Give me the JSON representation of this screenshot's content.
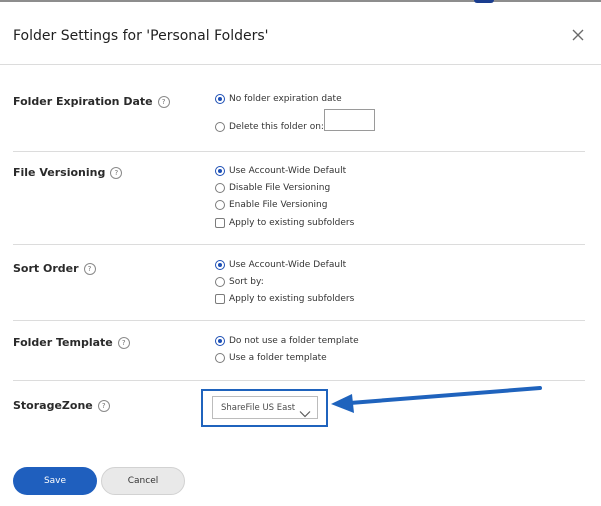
{
  "dialog": {
    "title": "Folder Settings for 'Personal Folders'",
    "close_icon": "close-icon"
  },
  "help_glyph": "?",
  "sections": {
    "expiration": {
      "label": "Folder Expiration Date",
      "options": [
        "No folder expiration date",
        "Delete this folder on:"
      ],
      "selected": "No folder expiration date",
      "date_value": ""
    },
    "versioning": {
      "label": "File Versioning",
      "options": [
        "Use Account-Wide Default",
        "Disable File Versioning",
        "Enable File Versioning"
      ],
      "selected": "Use Account-Wide Default",
      "apply_label": "Apply to existing subfolders",
      "apply_checked": false
    },
    "sort": {
      "label": "Sort Order",
      "options": [
        "Use Account-Wide Default",
        "Sort by:"
      ],
      "selected": "Use Account-Wide Default",
      "apply_label": "Apply to existing subfolders",
      "apply_checked": false
    },
    "template": {
      "label": "Folder Template",
      "options": [
        "Do not use a folder template",
        "Use a folder template"
      ],
      "selected": "Do not use a folder template"
    },
    "storage": {
      "label": "StorageZone",
      "selected_value": "ShareFile US East"
    }
  },
  "buttons": {
    "save": "Save",
    "cancel": "Cancel"
  },
  "colors": {
    "accent": "#1f5fbe",
    "annotation": "#1f63bd"
  }
}
